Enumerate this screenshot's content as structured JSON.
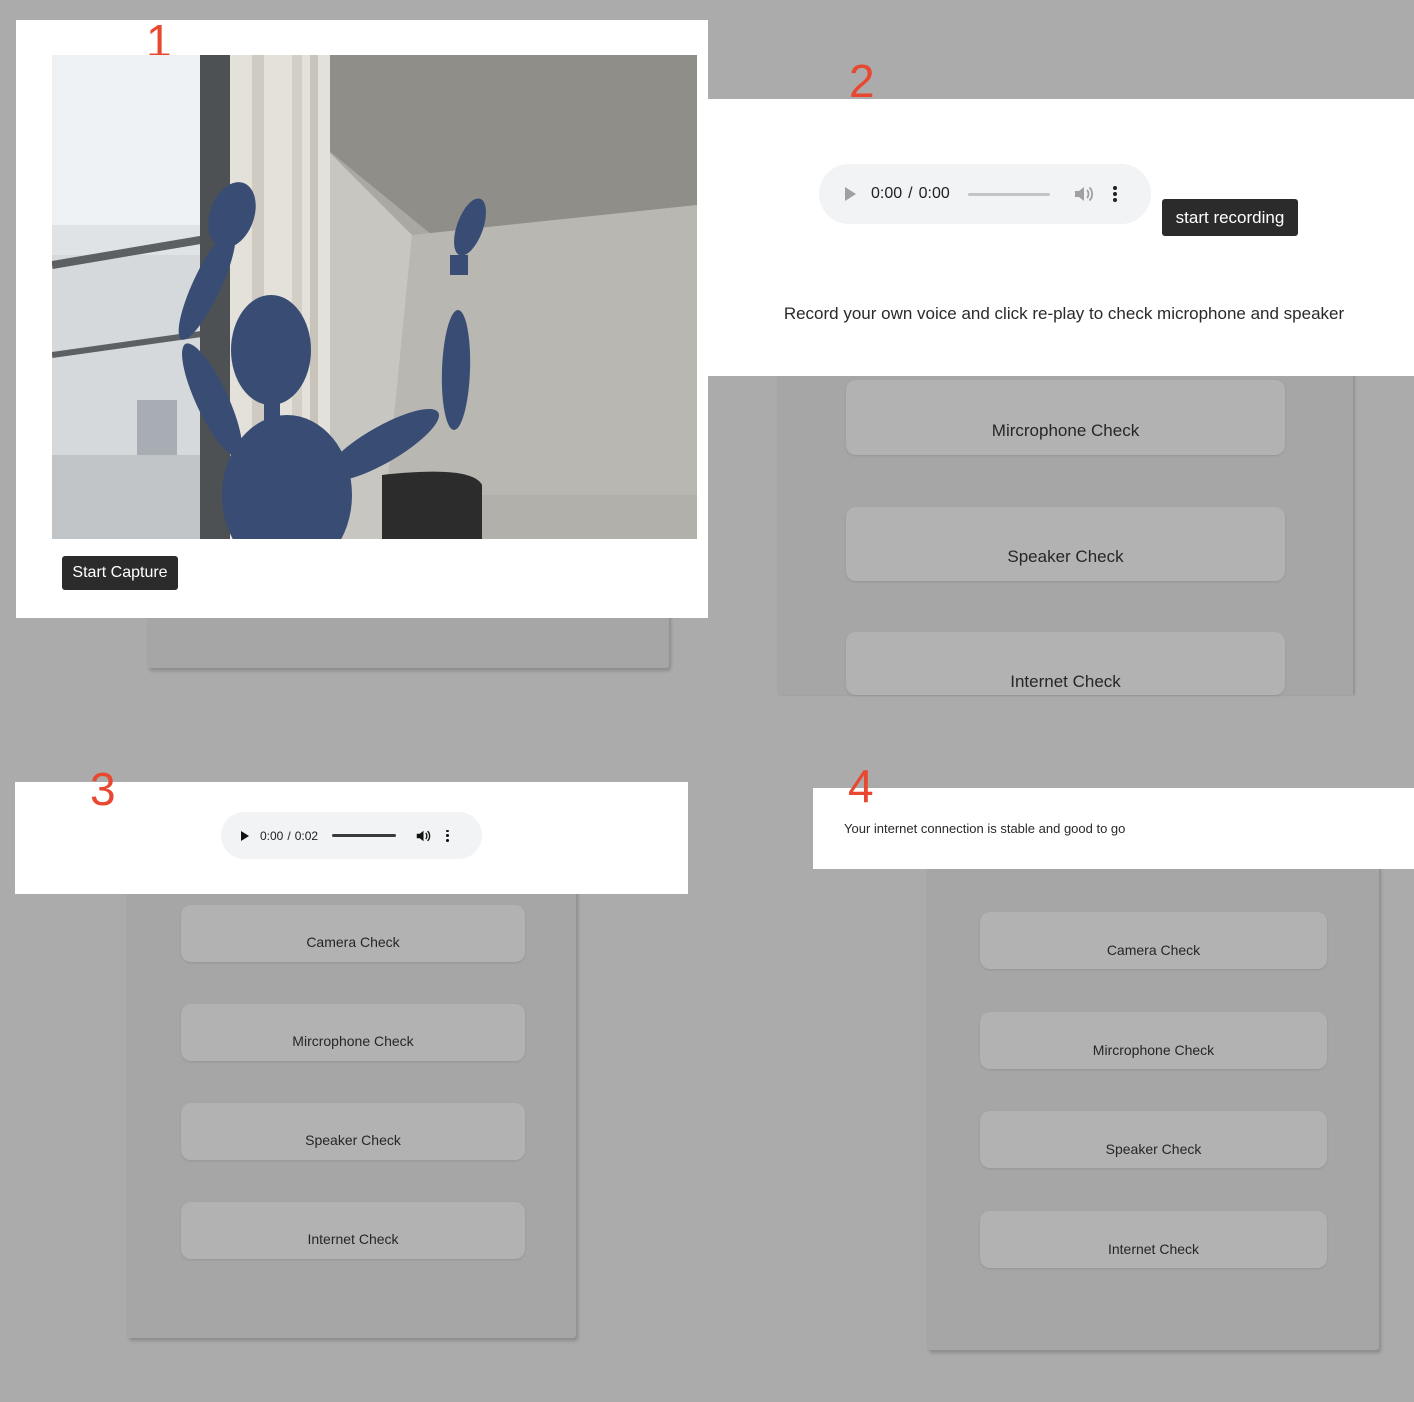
{
  "colors": {
    "step_number": "#e8482f",
    "page_bg": "#ababab",
    "panel_bg": "#a6a6a6",
    "button_bg": "#2b2b2b"
  },
  "step1": {
    "number": "1",
    "camera_feed": "webcam-preview",
    "capture_button": "Start Capture"
  },
  "step2": {
    "number": "2",
    "audio_player": {
      "current_time": "0:00",
      "separator": "/",
      "duration": "0:00"
    },
    "record_button": "start recording",
    "instruction": "Record your own voice and click re-play to check microphone and speaker",
    "checks": [
      "Mircrophone Check",
      "Speaker Check",
      "Internet Check"
    ]
  },
  "step3": {
    "number": "3",
    "audio_player": {
      "current_time": "0:00",
      "separator": "/",
      "duration": "0:02"
    },
    "checks": [
      "Camera Check",
      "Mircrophone Check",
      "Speaker Check",
      "Internet Check"
    ]
  },
  "step4": {
    "number": "4",
    "status_message": "Your internet connection is stable and good to go",
    "checks": [
      "Camera Check",
      "Mircrophone Check",
      "Speaker Check",
      "Internet Check"
    ]
  }
}
